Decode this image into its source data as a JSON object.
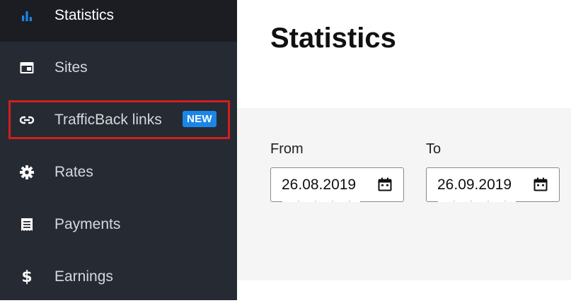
{
  "sidebar": {
    "items": [
      {
        "label": "Statistics",
        "icon": "bar-chart-icon"
      },
      {
        "label": "Sites",
        "icon": "browser-window-icon"
      },
      {
        "label": "TrafficBack links",
        "icon": "link-icon",
        "badge": "NEW"
      },
      {
        "label": "Rates",
        "icon": "gear-icon"
      },
      {
        "label": "Payments",
        "icon": "receipt-icon"
      },
      {
        "label": "Earnings",
        "icon": "dollar-icon"
      }
    ],
    "active_item": "Statistics"
  },
  "main": {
    "title": "Statistics",
    "filters": {
      "from_label": "From",
      "from_value": "26.08.2019",
      "to_label": "To",
      "to_value": "26.09.2019"
    }
  },
  "colors": {
    "sidebar_bg": "#262a33",
    "sidebar_active_bg": "#1b1d22",
    "accent": "#1a86e8",
    "highlight": "#d01f1f",
    "panel_bg": "#f5f5f5"
  }
}
